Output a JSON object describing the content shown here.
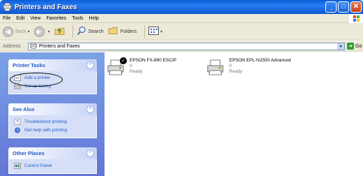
{
  "window": {
    "title": "Printers and Faxes"
  },
  "menu": {
    "items": [
      "File",
      "Edit",
      "View",
      "Favorites",
      "Tools",
      "Help"
    ]
  },
  "toolbar": {
    "back": "Back",
    "search": "Search",
    "folders": "Folders"
  },
  "address": {
    "label": "Address",
    "value": "Printers and Faxes",
    "go": "Go"
  },
  "task_pane": {
    "panels": [
      {
        "title": "Printer Tasks",
        "items": [
          {
            "label": "Add a printer",
            "icon": "add-printer-icon"
          },
          {
            "label": "Set up faxing",
            "icon": "fax-icon"
          }
        ]
      },
      {
        "title": "See Also",
        "items": [
          {
            "label": "Troubleshoot printing",
            "icon": "help-icon"
          },
          {
            "label": "Get help with printing",
            "icon": "help-globe-icon"
          }
        ]
      },
      {
        "title": "Other Places",
        "items": [
          {
            "label": "Control Panel",
            "icon": "control-panel-icon"
          }
        ]
      }
    ]
  },
  "printers": [
    {
      "name": "EPSON FX-890 ESC/P",
      "count": "0",
      "status": "Ready",
      "default": true
    },
    {
      "name": "EPSON EPL-N2500 Advanced",
      "count": "0",
      "status": "Ready",
      "default": false
    }
  ],
  "colors": {
    "title_bar": "#0a5fd8",
    "task_pane": "#7ba2e7",
    "task_link": "#215dc6"
  }
}
